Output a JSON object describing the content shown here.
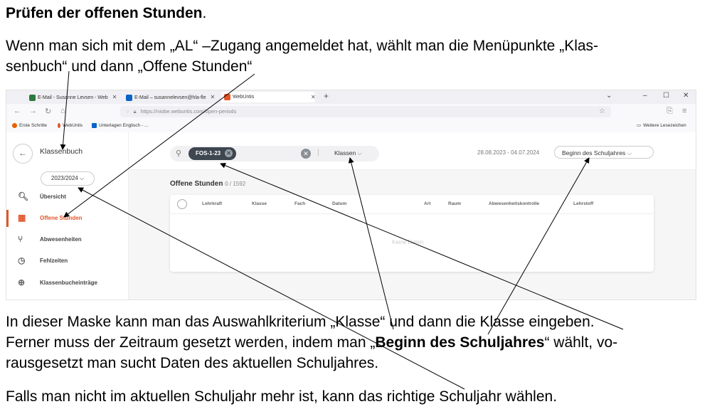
{
  "doc": {
    "heading_bold": "Prüfen der offenen Stunden",
    "heading_period": ".",
    "p1_line1": "Wenn man sich mit dem „AL“ –Zugang angemeldet hat, wählt man die Menüpunkte „Klas-",
    "p1_line2": "senbuch“ und dann „Offene Stunden“",
    "p2_line1": "In dieser Maske kann man das Auswahlkriterium „Klasse“ und dann die Klasse eingeben.",
    "p2_line2_pre": "Ferner muss der Zeitraum gesetzt werden, indem man „",
    "p2_line2_bold": "Beginn des Schuljahres",
    "p2_line2_post": "“ wählt, vo-",
    "p2_line3": "rausgesetzt man sucht Daten des aktuellen Schuljahres.",
    "p3": "Falls man nicht im aktuellen Schuljahr mehr ist, kann das richtige Schuljahr wählen."
  },
  "browser": {
    "tabs": [
      {
        "label": "E-Mail - Susanne Levsen - Web",
        "icon_color": "#2b7a3d"
      },
      {
        "label": "E-Mail – susannelevsen@hla-fle",
        "icon_color": "#0a64c8"
      },
      {
        "label": "WebUntis",
        "icon_color": "#e2562a"
      }
    ],
    "url": "https://niobe.webuntis.com/open-periods",
    "bookmarks": [
      {
        "label": "Erste Schritte",
        "icon_color": "#e66000"
      },
      {
        "label": "WebUntis",
        "icon_color": "#e2562a"
      },
      {
        "label": "Unterlagen Englisch - ...",
        "icon_color": "#0a64c8"
      }
    ],
    "other_bookmarks": "Weitere Lesezeichen"
  },
  "app": {
    "sidebar_title": "Klassenbuch",
    "school_year": "2023/2024",
    "menu": [
      {
        "label": "Übersicht",
        "icon": "search-doc-icon"
      },
      {
        "label": "Offene Stunden",
        "icon": "calendar-icon"
      },
      {
        "label": "Abwesenheiten",
        "icon": "chair-icon"
      },
      {
        "label": "Fehlzeiten",
        "icon": "clock-icon"
      },
      {
        "label": "Klassenbucheinträge",
        "icon": "book-add-icon"
      }
    ],
    "filter_chip": "FOS-1-23",
    "filter_type": "Klassen",
    "date_range": "28.08.2023 - 04.07.2024",
    "period_select": "Beginn des Schuljahres",
    "page_title": "Offene Stunden",
    "record_count": "0 / 1592",
    "columns": [
      "Lehrkraft",
      "Klasse",
      "Fach",
      "Datum",
      "Art",
      "Raum",
      "Abwesenheitskontrolle",
      "Lehrstoff"
    ],
    "no_data": "Keine Daten"
  }
}
